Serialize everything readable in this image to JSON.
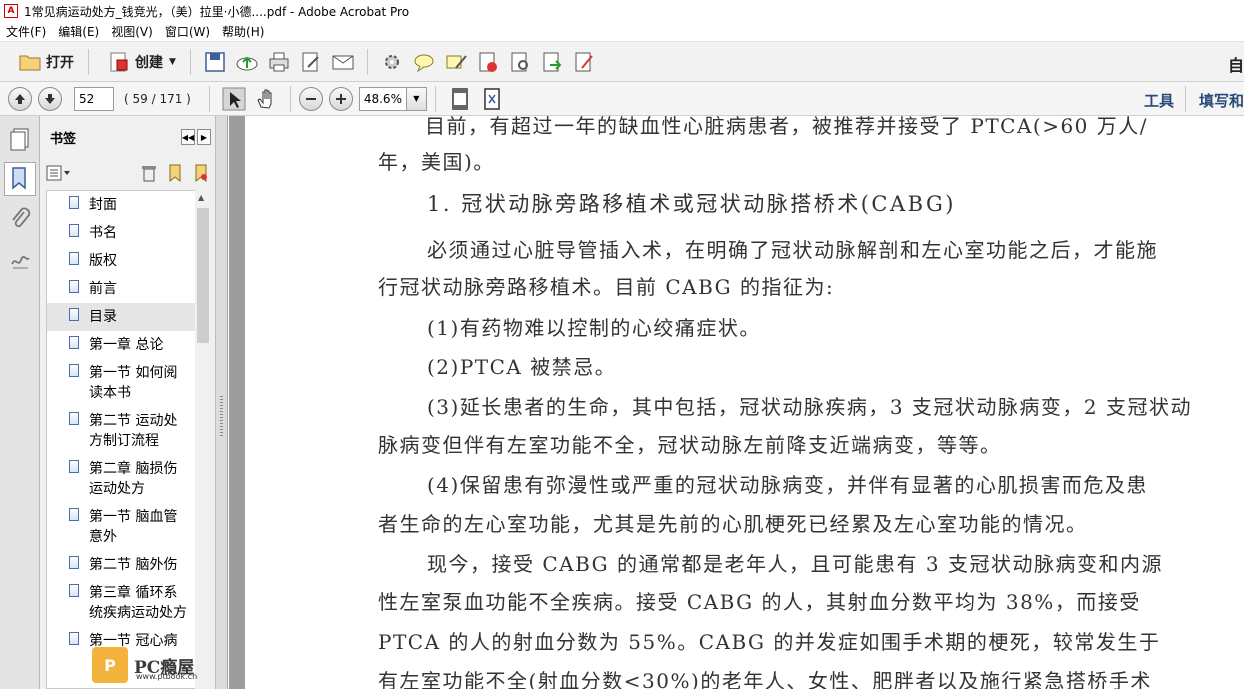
{
  "window": {
    "title": "1常见病运动处方_钱竞光，（美）拉里·小德....pdf - Adobe Acrobat Pro"
  },
  "menu": [
    "文件(F)",
    "编辑(E)",
    "视图(V)",
    "窗口(W)",
    "帮助(H)"
  ],
  "toolbar": {
    "open_label": "打开",
    "create_label": "创建",
    "right_label": "自"
  },
  "nav": {
    "current_page": "52",
    "page_count": "( 59 / 171 )",
    "zoom": "48.6%",
    "tools_label": "工具",
    "sign_label": "填写和"
  },
  "bookmarks": {
    "title": "书签",
    "items": [
      {
        "label": "封面",
        "selected": false
      },
      {
        "label": "书名",
        "selected": false
      },
      {
        "label": "版权",
        "selected": false
      },
      {
        "label": "前言",
        "selected": false
      },
      {
        "label": "目录",
        "selected": true
      },
      {
        "label": "第一章 总论",
        "selected": false
      },
      {
        "label": " 第一节 如何阅读本书",
        "selected": false
      },
      {
        "label": " 第二节 运动处方制订流程",
        "selected": false
      },
      {
        "label": "第二章 脑损伤运动处方",
        "selected": false
      },
      {
        "label": " 第一节 脑血管意外",
        "selected": false
      },
      {
        "label": " 第二节 脑外伤",
        "selected": false
      },
      {
        "label": "第三章 循环系统疾病运动处方",
        "selected": false
      },
      {
        "label": " 第一节 冠心病",
        "selected": false
      }
    ]
  },
  "document": {
    "lines": [
      {
        "text": "目前，有超过一年的缺血性心脏病患者，被推荐并接受了 PTCA(>60 万人/",
        "indent": 180,
        "heading": false
      },
      {
        "text": "年，美国)。",
        "indent": 133,
        "heading": false
      },
      {
        "text": "1. 冠状动脉旁路移植术或冠状动脉搭桥术(CABG)",
        "indent": 182,
        "heading": true
      },
      {
        "text": "必须通过心脏导管插入术，在明确了冠状动脉解剖和左心室功能之后，才能施",
        "indent": 182,
        "heading": false
      },
      {
        "text": "行冠状动脉旁路移植术。目前 CABG 的指征为:",
        "indent": 133,
        "heading": false
      },
      {
        "text": "(1)有药物难以控制的心绞痛症状。",
        "indent": 182,
        "heading": false
      },
      {
        "text": "(2)PTCA 被禁忌。",
        "indent": 182,
        "heading": false
      },
      {
        "text": "(3)延长患者的生命，其中包括，冠状动脉疾病，3 支冠状动脉病变，2 支冠状动",
        "indent": 182,
        "heading": false
      },
      {
        "text": "脉病变但伴有左室功能不全，冠状动脉左前降支近端病变，等等。",
        "indent": 133,
        "heading": false
      },
      {
        "text": "(4)保留患有弥漫性或严重的冠状动脉病变，并伴有显著的心肌损害而危及患",
        "indent": 182,
        "heading": false
      },
      {
        "text": "者生命的左心室功能，尤其是先前的心肌梗死已经累及左心室功能的情况。",
        "indent": 133,
        "heading": false
      },
      {
        "text": "现今，接受 CABG 的通常都是老年人，且可能患有 3 支冠状动脉病变和内源",
        "indent": 182,
        "heading": false
      },
      {
        "text": "性左室泵血功能不全疾病。接受 CABG 的人，其射血分数平均为 38%，而接受",
        "indent": 133,
        "heading": false
      },
      {
        "text": "PTCA 的人的射血分数为 55%。CABG 的并发症如围手术期的梗死，较常发生于",
        "indent": 133,
        "heading": false
      },
      {
        "text": "有左室功能不全(射血分数<30%)的老年人、女性、肥胖者以及施行紧急搭桥手术",
        "indent": 133,
        "heading": false
      }
    ]
  },
  "watermark": {
    "text": "PC瘾屋",
    "url": "www.ptbook.cn"
  }
}
